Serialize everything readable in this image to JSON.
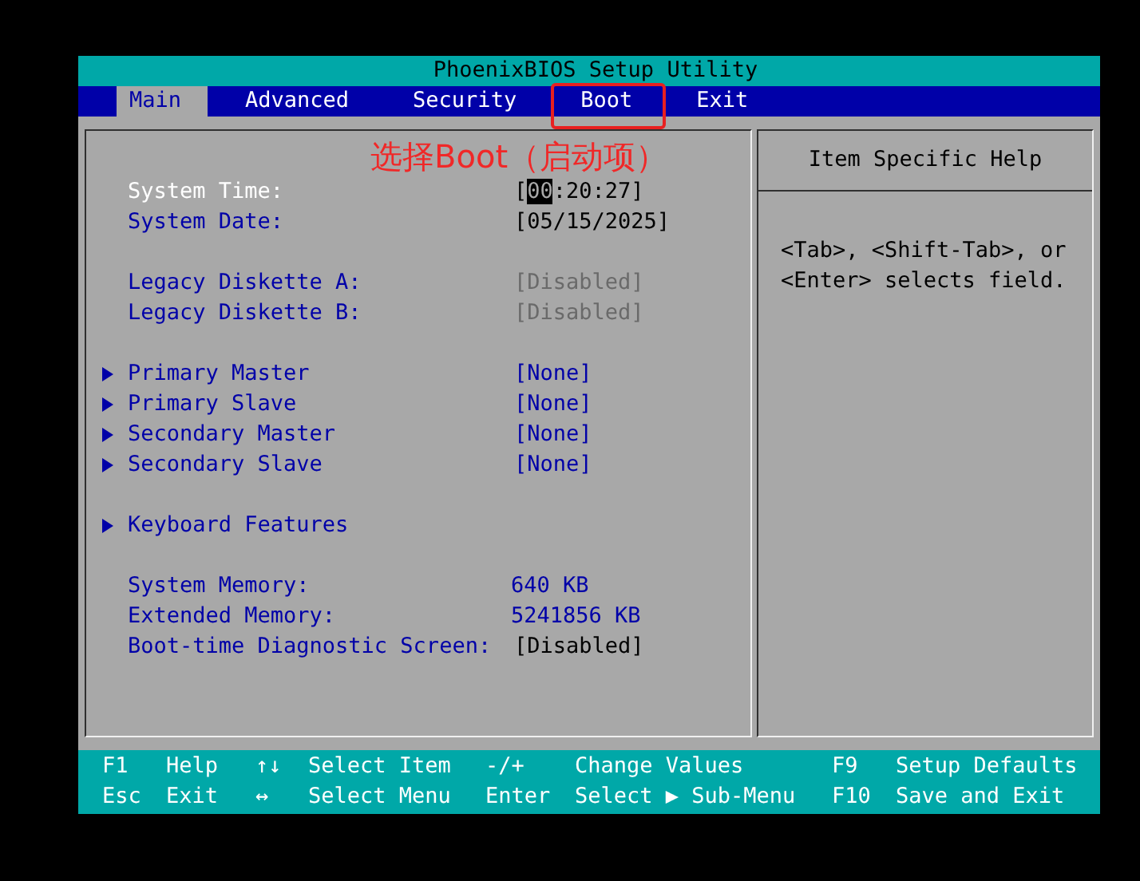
{
  "window": {
    "title": "PhoenixBIOS Setup Utility"
  },
  "tabs": [
    {
      "label": "Main",
      "selected": true,
      "marked": false
    },
    {
      "label": "Advanced",
      "selected": false,
      "marked": false
    },
    {
      "label": "Security",
      "selected": false,
      "marked": false
    },
    {
      "label": "Boot",
      "selected": false,
      "marked": true
    },
    {
      "label": "Exit",
      "selected": false,
      "marked": false
    }
  ],
  "annotation": {
    "text": "选择Boot（启动项）"
  },
  "groups": [
    [
      {
        "kind": "field",
        "label": "System Time:",
        "selected": true,
        "value_parts": [
          {
            "text": "[",
            "highlighted": false
          },
          {
            "text": "00",
            "highlighted": true
          },
          {
            "text": ":20:27]",
            "highlighted": false
          }
        ]
      },
      {
        "kind": "field",
        "label": "System Date:",
        "selected": false,
        "value": "[05/15/2025]"
      }
    ],
    [
      {
        "kind": "field",
        "label": "Legacy Diskette A:",
        "selected": false,
        "disabled": true,
        "value": "[Disabled]"
      },
      {
        "kind": "field",
        "label": "Legacy Diskette B:",
        "selected": false,
        "disabled": true,
        "value": "[Disabled]"
      }
    ],
    [
      {
        "kind": "submenu",
        "label": "Primary Master",
        "selected": false,
        "value": "[None]"
      },
      {
        "kind": "submenu",
        "label": "Primary Slave",
        "selected": false,
        "value": "[None]"
      },
      {
        "kind": "submenu",
        "label": "Secondary Master",
        "selected": false,
        "value": "[None]"
      },
      {
        "kind": "submenu",
        "label": "Secondary Slave",
        "selected": false,
        "value": "[None]"
      }
    ],
    [
      {
        "kind": "submenu",
        "label": "Keyboard Features",
        "selected": false
      }
    ],
    [
      {
        "kind": "info",
        "label": "System Memory:",
        "selected": false,
        "value": "640 KB"
      },
      {
        "kind": "info",
        "label": "Extended Memory:",
        "selected": false,
        "value": "5241856 KB"
      },
      {
        "kind": "field",
        "label": "Boot-time Diagnostic Screen:",
        "selected": false,
        "disabled": false,
        "value": "[Disabled]"
      }
    ]
  ],
  "help": {
    "title": "Item Specific Help",
    "text": "<Tab>, <Shift-Tab>, or <Enter> selects field."
  },
  "footer": [
    [
      {
        "key": "F1",
        "action": "Help"
      },
      {
        "key": "↑↓",
        "action": "Select Item"
      },
      {
        "key": "-/+",
        "action": "Change Values"
      },
      {
        "key": "F9",
        "action": "Setup Defaults"
      }
    ],
    [
      {
        "key": "Esc",
        "action": "Exit"
      },
      {
        "key": "↔",
        "action": "Select Menu"
      },
      {
        "key": "Enter",
        "action": "Select ▶ Sub-Menu"
      },
      {
        "key": "F10",
        "action": "Save and Exit"
      }
    ]
  ]
}
